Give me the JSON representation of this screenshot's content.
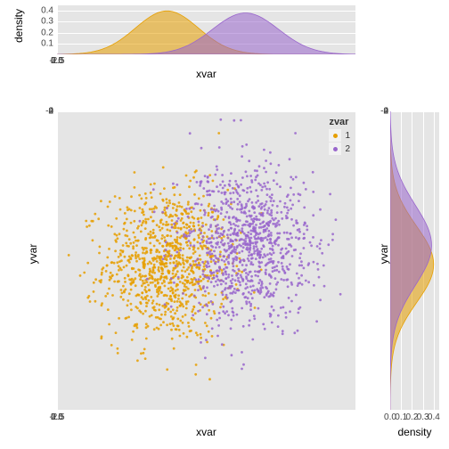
{
  "chart_data": {
    "type": "scatter",
    "panels": {
      "top_density": {
        "type": "area",
        "xlabel": "xvar",
        "ylabel": "density",
        "xlim": [
          -4.5,
          5.0
        ],
        "ylim": [
          0.0,
          0.45
        ],
        "xticks": [
          -2.5,
          0.0,
          2.5,
          5.0
        ],
        "yticks": [
          0.1,
          0.2,
          0.3,
          0.4
        ],
        "series": [
          {
            "name": "1",
            "color": "#E69F00",
            "distribution": "normal",
            "mean": -1.0,
            "sd": 1.0,
            "peak": 0.4
          },
          {
            "name": "2",
            "color": "#9966CC",
            "distribution": "normal",
            "mean": 1.5,
            "sd": 1.05,
            "peak": 0.38
          }
        ]
      },
      "main_scatter": {
        "type": "scatter",
        "xlabel": "xvar",
        "ylabel": "yvar",
        "xlim": [
          -4.5,
          5.0
        ],
        "ylim": [
          -2.8,
          5.0
        ],
        "xticks": [
          -2.5,
          0.0,
          2.5,
          5.0
        ],
        "yticks": [
          -2,
          0,
          2,
          4
        ],
        "series": [
          {
            "name": "1",
            "color": "#E69F00",
            "n": 1000,
            "mean_x": -1.0,
            "sd_x": 1.0,
            "mean_y": 1.0,
            "sd_y": 1.0
          },
          {
            "name": "2",
            "color": "#9966CC",
            "n": 1000,
            "mean_x": 1.5,
            "sd_x": 1.05,
            "mean_y": 1.5,
            "sd_y": 1.05
          }
        ],
        "legend_title": "zvar"
      },
      "right_density": {
        "type": "area",
        "xlabel": "density",
        "ylabel": "yvar",
        "xlim": [
          0.0,
          0.45
        ],
        "ylim": [
          -2.8,
          5.0
        ],
        "xticks": [
          0.0,
          0.1,
          0.2,
          0.3,
          0.4
        ],
        "yticks": [
          -2,
          0,
          2,
          4
        ],
        "series": [
          {
            "name": "1",
            "color": "#E69F00",
            "distribution": "normal",
            "mean": 1.0,
            "sd": 1.0,
            "peak": 0.4
          },
          {
            "name": "2",
            "color": "#9966CC",
            "distribution": "normal",
            "mean": 1.5,
            "sd": 1.05,
            "peak": 0.38
          }
        ]
      }
    }
  },
  "labels": {
    "xvar": "xvar",
    "yvar": "yvar",
    "density": "density",
    "zvar": "zvar",
    "g1": "1",
    "g2": "2"
  },
  "colors": {
    "g1": "#E69F00",
    "g2": "#9966CC",
    "g1_fill": "rgba(230,159,0,0.55)",
    "g2_fill": "rgba(153,102,204,0.55)",
    "panel_bg": "#e5e5e5"
  }
}
